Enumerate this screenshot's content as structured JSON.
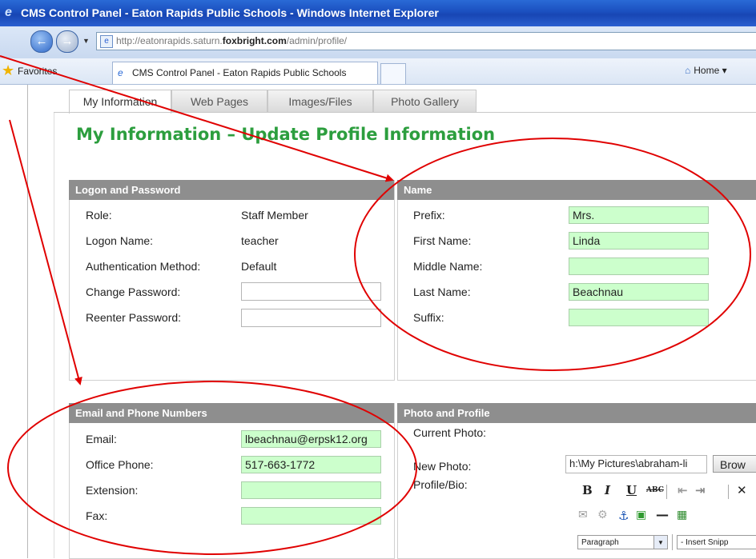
{
  "browser": {
    "title": "CMS Control Panel - Eaton Rapids Public Schools - Windows Internet Explorer",
    "url_prefix": "http://eatonrapids.saturn.",
    "url_domain": "foxbright.com",
    "url_path": "/admin/profile/",
    "favorites_label": "Favorites",
    "tab_label": "CMS Control Panel - Eaton Rapids Public Schools",
    "home_label": "Home"
  },
  "app_tabs": [
    "My Information",
    "Web Pages",
    "Images/Files",
    "Photo Gallery"
  ],
  "page_title": "My Information – Update Profile Information",
  "logon": {
    "header": "Logon and Password",
    "role_label": "Role:",
    "role_value": "Staff Member",
    "logon_label": "Logon Name:",
    "logon_value": "teacher",
    "auth_label": "Authentication Method:",
    "auth_value": "Default",
    "change_pw_label": "Change Password:",
    "reenter_pw_label": "Reenter Password:"
  },
  "name": {
    "header": "Name",
    "prefix_label": "Prefix:",
    "prefix_value": "Mrs.",
    "first_label": "First Name:",
    "first_value": "Linda",
    "middle_label": "Middle Name:",
    "middle_value": "",
    "last_label": "Last Name:",
    "last_value": "Beachnau",
    "suffix_label": "Suffix:",
    "suffix_value": ""
  },
  "contact": {
    "header": "Email and Phone Numbers",
    "email_label": "Email:",
    "email_value": "lbeachnau@erpsk12.org",
    "office_label": "Office Phone:",
    "office_value": "517-663-1772",
    "ext_label": "Extension:",
    "ext_value": "",
    "fax_label": "Fax:",
    "fax_value": ""
  },
  "photo": {
    "header": "Photo and Profile",
    "current_label": "Current Photo:",
    "new_label": "New Photo:",
    "new_value": "h:\\My Pictures\\abraham-li",
    "browse_label": "Brow",
    "bio_label": "Profile/Bio:",
    "format_select": "Paragraph",
    "snippet_select": "- Insert Snipp"
  },
  "colors": {
    "field_green": "#ccffcc",
    "title_green": "#2c9e3e",
    "annotation_red": "#e00000",
    "panel_header": "#8e8e8e"
  }
}
